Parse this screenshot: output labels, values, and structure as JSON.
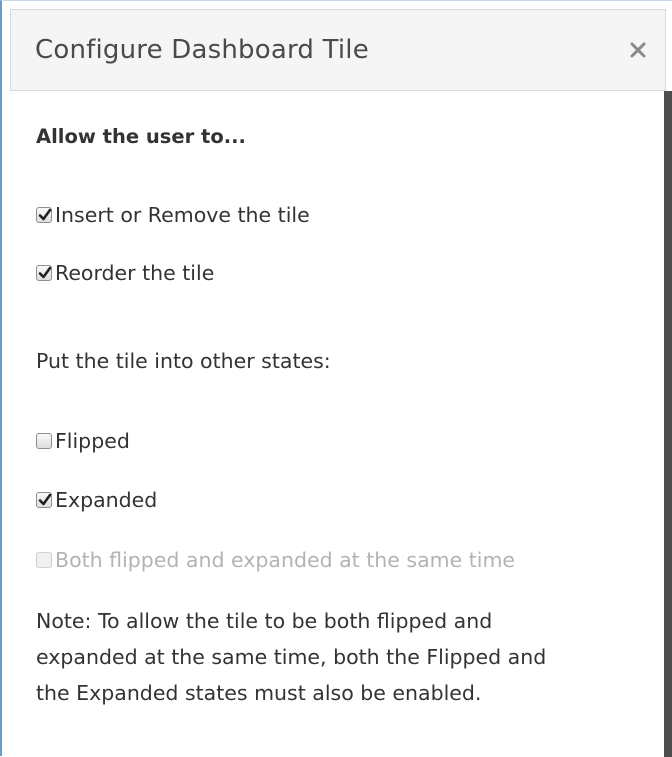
{
  "dialog": {
    "title": "Configure Dashboard Tile",
    "close_icon": "close-icon"
  },
  "permissions": {
    "heading": "Allow the user to...",
    "items": [
      {
        "label": "Insert or Remove the tile",
        "checked": true,
        "enabled": true
      },
      {
        "label": "Reorder the tile",
        "checked": true,
        "enabled": true
      }
    ]
  },
  "states": {
    "heading": "Put the tile into other states:",
    "items": [
      {
        "label": "Flipped",
        "checked": false,
        "enabled": true
      },
      {
        "label": "Expanded",
        "checked": true,
        "enabled": true
      },
      {
        "label": "Both flipped and expanded at the same time",
        "checked": false,
        "enabled": false
      }
    ]
  },
  "note": {
    "lines": [
      "Note: To allow the tile to be both flipped and",
      "expanded at the same time, both the Flipped and",
      "the Expanded states must also be enabled."
    ]
  },
  "colors": {
    "accent_border": "#6d9bc8",
    "text": "#333333",
    "disabled_text": "#b3b3b3",
    "titlebar_bg": "#f5f5f5"
  }
}
